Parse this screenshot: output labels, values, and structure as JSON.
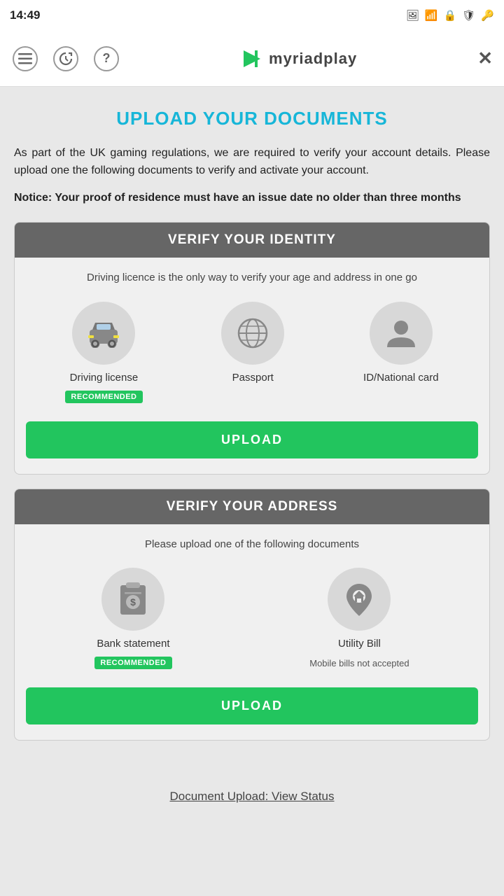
{
  "statusBar": {
    "time": "14:49",
    "icons": [
      "image",
      "wifi-alt",
      "vpn",
      "security"
    ]
  },
  "nav": {
    "menuLabel": "☰",
    "historyLabel": "↺",
    "helpLabel": "?",
    "logoText": "myriadplay",
    "closeLabel": "✕"
  },
  "page": {
    "title": "UPLOAD YOUR DOCUMENTS",
    "introText": "As part of the UK gaming regulations, we are required to verify your account details. Please upload one the following documents to verify and activate your account.",
    "noticeText": "Notice: Your proof of residence must have an issue date no older than three months"
  },
  "identityCard": {
    "header": "VERIFY YOUR IDENTITY",
    "subtitle": "Driving licence is the only way to verify your age and address in one go",
    "options": [
      {
        "label": "Driving license",
        "recommended": true
      },
      {
        "label": "Passport",
        "recommended": false
      },
      {
        "label": "ID/National card",
        "recommended": false
      }
    ],
    "uploadButton": "UPLOAD"
  },
  "addressCard": {
    "header": "VERIFY YOUR ADDRESS",
    "subtitle": "Please upload one of the following documents",
    "options": [
      {
        "label": "Bank statement",
        "sublabel": "",
        "recommended": true
      },
      {
        "label": "Utility Bill",
        "sublabel": "Mobile bills not accepted",
        "recommended": false
      }
    ],
    "uploadButton": "UPLOAD"
  },
  "bottomLink": "Document Upload: View Status",
  "badges": {
    "recommended": "RECOMMENDED"
  }
}
